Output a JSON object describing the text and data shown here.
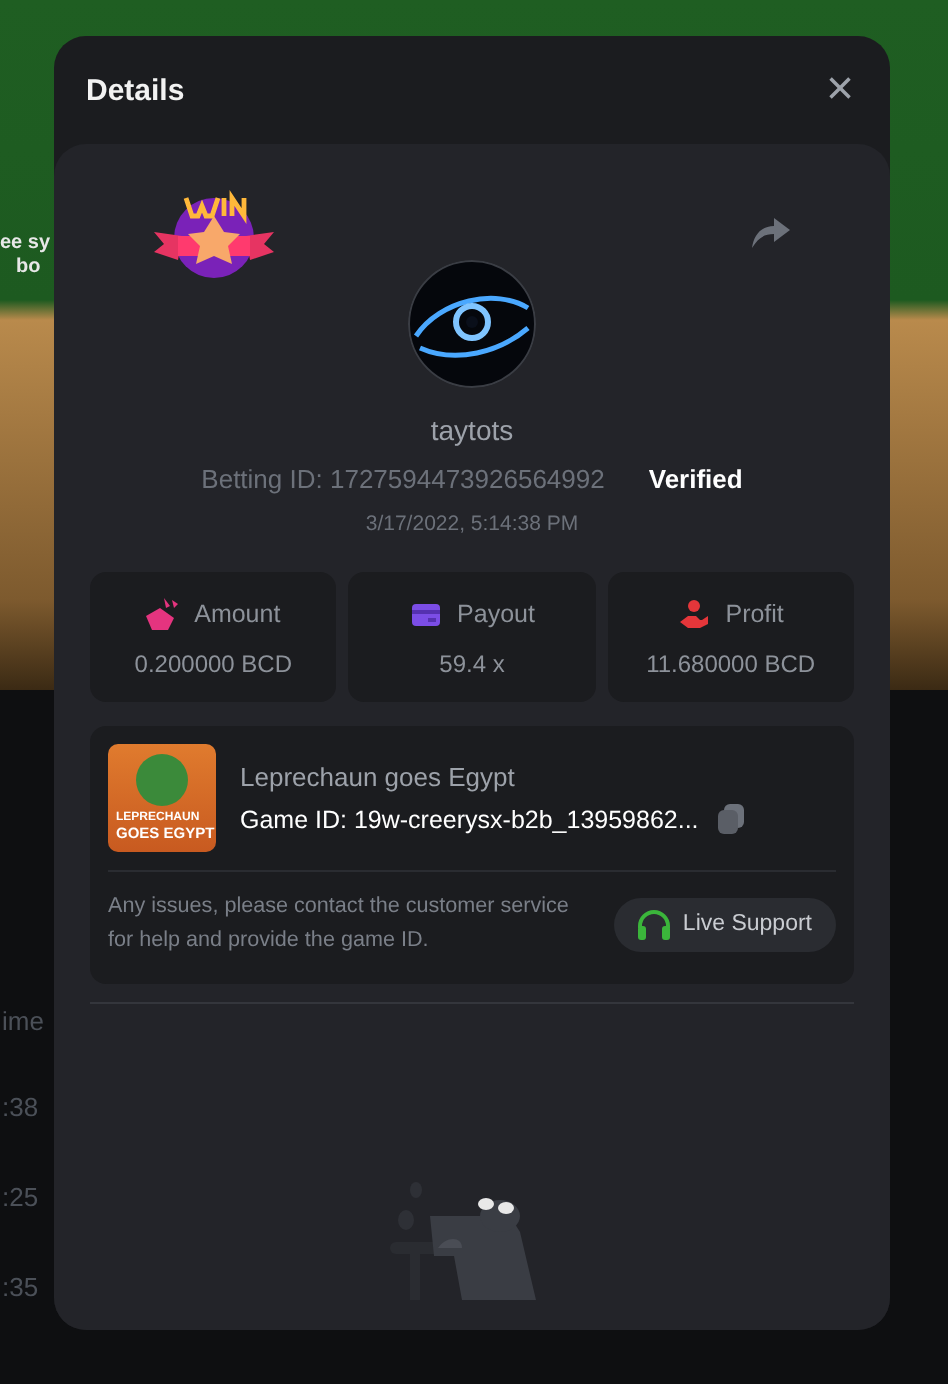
{
  "background": {
    "slot_texts": [
      "ee sy",
      "bo"
    ],
    "table_header": "ime",
    "times": [
      ":38",
      ":25",
      ":35"
    ]
  },
  "modal": {
    "title": "Details",
    "close": "×",
    "player": {
      "name": "taytots",
      "betting_id": "Betting ID: 1727594473926564992",
      "verified": "Verified",
      "date": "3/17/2022, 5:14:38 PM"
    },
    "stats": [
      {
        "kind": "amount",
        "label": "Amount",
        "value": "0.200000 BCD"
      },
      {
        "kind": "payout",
        "label": "Payout",
        "value": "59.4 x"
      },
      {
        "kind": "profit",
        "label": "Profit",
        "value": "11.680000 BCD"
      }
    ],
    "game": {
      "thumbnail_text_1": "LEPRECHAUN",
      "thumbnail_text_2": "GOES EGYPT",
      "name": "Leprechaun goes Egypt",
      "game_id": "Game ID: 19w-creerysx-b2b_13959862...",
      "help": "Any issues, please contact the customer service for help and provide the game ID.",
      "support_button": "Live Support"
    }
  }
}
